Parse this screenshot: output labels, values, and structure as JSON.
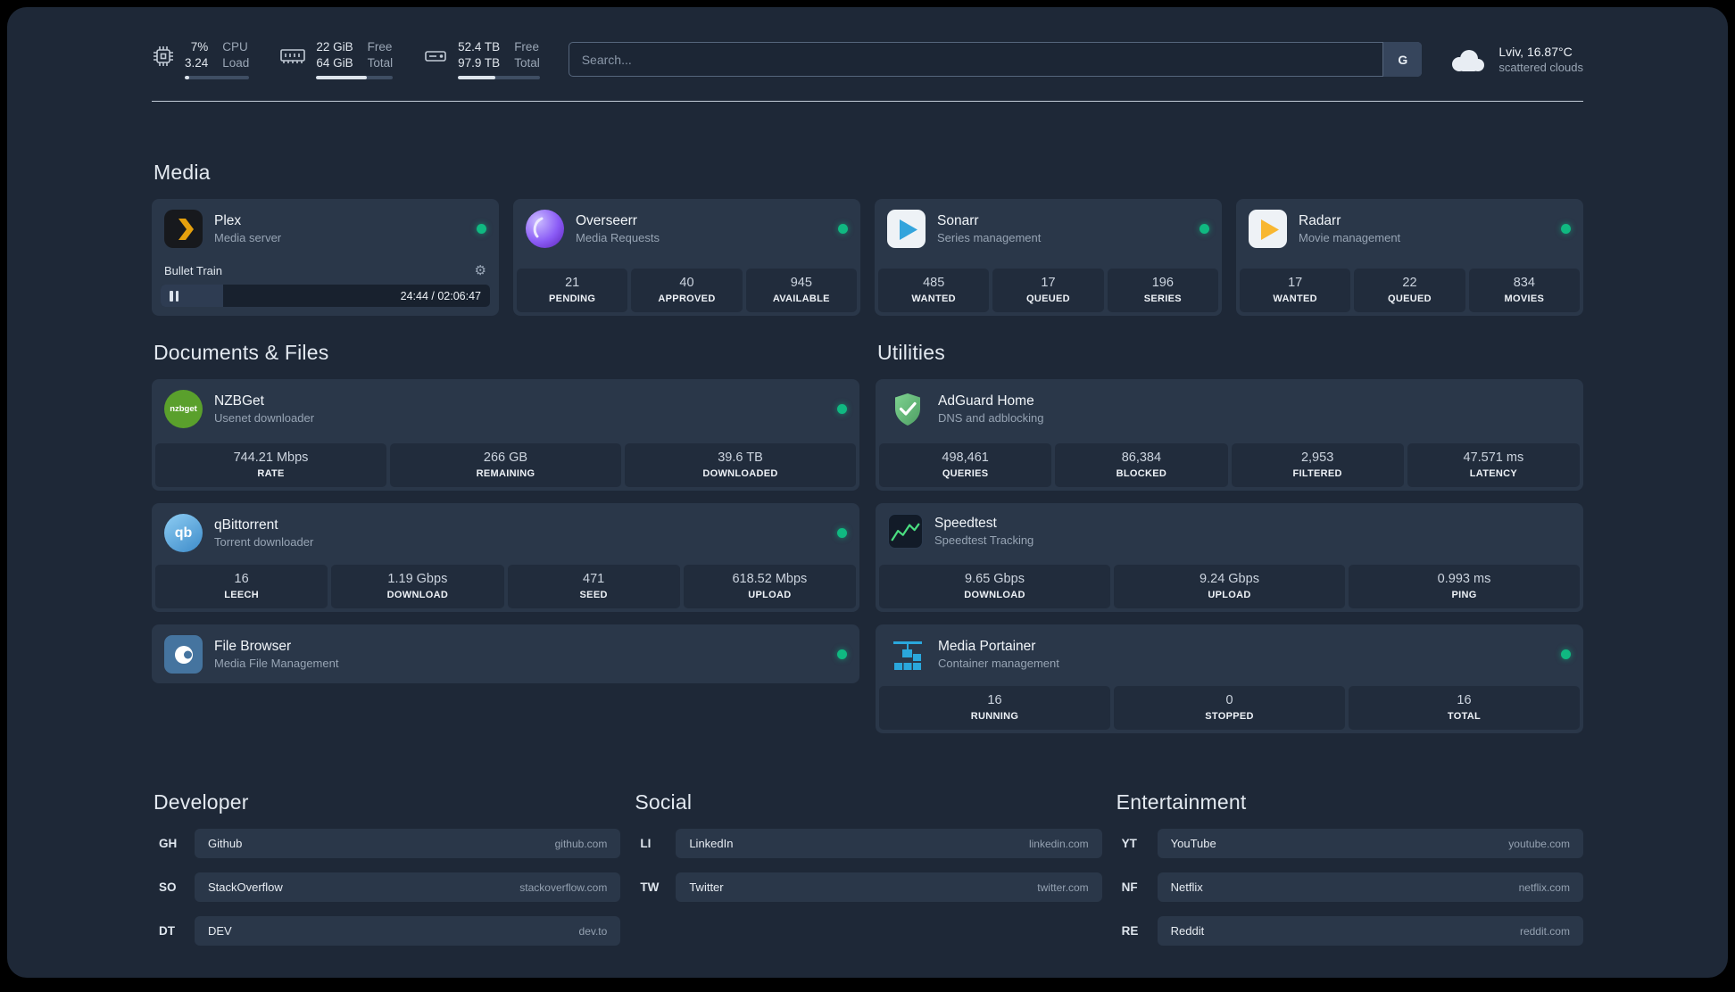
{
  "topbar": {
    "widgets": [
      {
        "icon": "cpu-icon",
        "val1": "7%",
        "lab1": "CPU",
        "val2": "3.24",
        "lab2": "Load",
        "progress_pct": 7
      },
      {
        "icon": "memory-icon",
        "val1": "22 GiB",
        "lab1": "Free",
        "val2": "64 GiB",
        "lab2": "Total",
        "progress_pct": 66
      },
      {
        "icon": "disk-icon",
        "val1": "52.4 TB",
        "lab1": "Free",
        "val2": "97.9 TB",
        "lab2": "Total",
        "progress_pct": 46
      }
    ],
    "search": {
      "placeholder": "Search...",
      "button_label": "G"
    },
    "weather": {
      "location": "Lviv, 16.87°C",
      "condition": "scattered clouds"
    }
  },
  "media": {
    "title": "Media",
    "plex": {
      "name": "Plex",
      "desc": "Media server",
      "track": "Bullet Train",
      "time": "24:44 / 02:06:47",
      "progress_pct": 19
    },
    "overseerr": {
      "name": "Overseerr",
      "desc": "Media Requests",
      "stats": [
        {
          "value": "21",
          "label": "PENDING"
        },
        {
          "value": "40",
          "label": "APPROVED"
        },
        {
          "value": "945",
          "label": "AVAILABLE"
        }
      ]
    },
    "sonarr": {
      "name": "Sonarr",
      "desc": "Series management",
      "stats": [
        {
          "value": "485",
          "label": "WANTED"
        },
        {
          "value": "17",
          "label": "QUEUED"
        },
        {
          "value": "196",
          "label": "SERIES"
        }
      ]
    },
    "radarr": {
      "name": "Radarr",
      "desc": "Movie management",
      "stats": [
        {
          "value": "17",
          "label": "WANTED"
        },
        {
          "value": "22",
          "label": "QUEUED"
        },
        {
          "value": "834",
          "label": "MOVIES"
        }
      ]
    }
  },
  "documents": {
    "title": "Documents & Files",
    "nzbget": {
      "name": "NZBGet",
      "desc": "Usenet downloader",
      "icon_text": "nzbget",
      "stats": [
        {
          "value": "744.21 Mbps",
          "label": "RATE"
        },
        {
          "value": "266 GB",
          "label": "REMAINING"
        },
        {
          "value": "39.6 TB",
          "label": "DOWNLOADED"
        }
      ]
    },
    "qbittorrent": {
      "name": "qBittorrent",
      "desc": "Torrent downloader",
      "icon_text": "qb",
      "stats": [
        {
          "value": "16",
          "label": "LEECH"
        },
        {
          "value": "1.19 Gbps",
          "label": "DOWNLOAD"
        },
        {
          "value": "471",
          "label": "SEED"
        },
        {
          "value": "618.52 Mbps",
          "label": "UPLOAD"
        }
      ]
    },
    "filebrowser": {
      "name": "File Browser",
      "desc": "Media File Management"
    }
  },
  "utilities": {
    "title": "Utilities",
    "adguard": {
      "name": "AdGuard Home",
      "desc": "DNS and adblocking",
      "stats": [
        {
          "value": "498,461",
          "label": "QUERIES"
        },
        {
          "value": "86,384",
          "label": "BLOCKED"
        },
        {
          "value": "2,953",
          "label": "FILTERED"
        },
        {
          "value": "47.571 ms",
          "label": "LATENCY"
        }
      ]
    },
    "speedtest": {
      "name": "Speedtest",
      "desc": "Speedtest Tracking",
      "stats": [
        {
          "value": "9.65 Gbps",
          "label": "DOWNLOAD"
        },
        {
          "value": "9.24 Gbps",
          "label": "UPLOAD"
        },
        {
          "value": "0.993 ms",
          "label": "PING"
        }
      ]
    },
    "portainer": {
      "name": "Media Portainer",
      "desc": "Container management",
      "stats": [
        {
          "value": "16",
          "label": "RUNNING"
        },
        {
          "value": "0",
          "label": "STOPPED"
        },
        {
          "value": "16",
          "label": "TOTAL"
        }
      ]
    }
  },
  "bookmarks": [
    {
      "title": "Developer",
      "items": [
        {
          "abbr": "GH",
          "name": "Github",
          "url": "github.com"
        },
        {
          "abbr": "SO",
          "name": "StackOverflow",
          "url": "stackoverflow.com"
        },
        {
          "abbr": "DT",
          "name": "DEV",
          "url": "dev.to"
        }
      ]
    },
    {
      "title": "Social",
      "items": [
        {
          "abbr": "LI",
          "name": "LinkedIn",
          "url": "linkedin.com"
        },
        {
          "abbr": "TW",
          "name": "Twitter",
          "url": "twitter.com"
        }
      ]
    },
    {
      "title": "Entertainment",
      "items": [
        {
          "abbr": "YT",
          "name": "YouTube",
          "url": "youtube.com"
        },
        {
          "abbr": "NF",
          "name": "Netflix",
          "url": "netflix.com"
        },
        {
          "abbr": "RE",
          "name": "Reddit",
          "url": "reddit.com"
        }
      ]
    }
  ],
  "colors": {
    "status_online": "#10b981",
    "plex_accent": "#e5a00d",
    "page_background": "#1e2837",
    "card_background": "#2a3749"
  }
}
